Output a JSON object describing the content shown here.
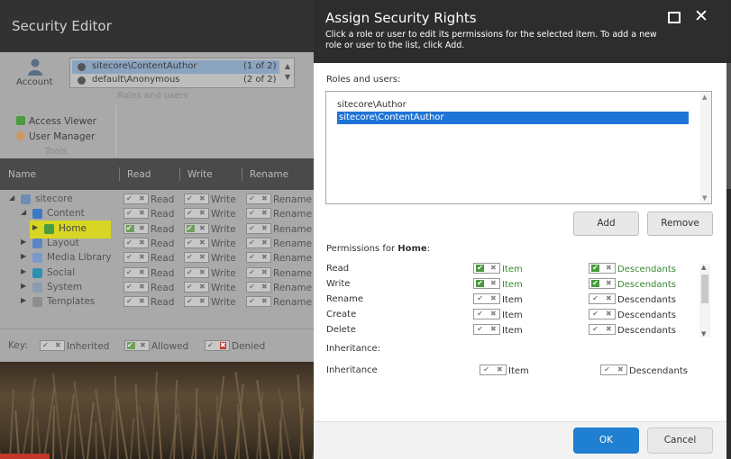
{
  "editor": {
    "title": "Security Editor",
    "ribbon": {
      "account_label": "Account",
      "users": [
        {
          "name": "sitecore\\ContentAuthor",
          "count": "(1 of 2)",
          "selected": true
        },
        {
          "name": "default\\Anonymous",
          "count": "(2 of 2)",
          "selected": false
        }
      ],
      "roles_group_label": "Roles and users",
      "tools": [
        "Access Viewer",
        "User Manager"
      ],
      "tools_group_label": "Tools"
    },
    "grid_headers": [
      "Name",
      "Read",
      "Write",
      "Rename"
    ],
    "tree": [
      {
        "label": "sitecore",
        "level": 0,
        "arrow": "◢"
      },
      {
        "label": "Content",
        "level": 1,
        "arrow": "◢"
      },
      {
        "label": "Home",
        "level": 2,
        "arrow": "▶",
        "highlighted": true,
        "allowed": true
      },
      {
        "label": "Layout",
        "level": 1,
        "arrow": "▶"
      },
      {
        "label": "Media Library",
        "level": 1,
        "arrow": "▶"
      },
      {
        "label": "Social",
        "level": 1,
        "arrow": "▶"
      },
      {
        "label": "System",
        "level": 1,
        "arrow": "▶"
      },
      {
        "label": "Templates",
        "level": 1,
        "arrow": "▶"
      }
    ],
    "perm_cells": [
      "Read",
      "Write",
      "Rename"
    ],
    "key": {
      "label": "Key:",
      "inherited": "Inherited",
      "allowed": "Allowed",
      "denied": "Denied"
    }
  },
  "dialog": {
    "title": "Assign Security Rights",
    "subtitle": "Click a role or user to edit its permissions for the selected item. To add a new role or user to the list, click Add.",
    "roles_label": "Roles and users:",
    "roles": [
      {
        "name": "sitecore\\Author",
        "selected": false
      },
      {
        "name": "sitecore\\ContentAuthor",
        "selected": true
      }
    ],
    "add_label": "Add",
    "remove_label": "Remove",
    "permissions_prefix": "Permissions for",
    "permissions_item": "Home",
    "permissions": [
      {
        "name": "Read",
        "item": "Item",
        "desc": "Descendants",
        "item_allowed": true,
        "desc_allowed": true
      },
      {
        "name": "Write",
        "item": "Item",
        "desc": "Descendants",
        "item_allowed": true,
        "desc_allowed": true
      },
      {
        "name": "Rename",
        "item": "Item",
        "desc": "Descendants",
        "item_allowed": false,
        "desc_allowed": false
      },
      {
        "name": "Create",
        "item": "Item",
        "desc": "Descendants",
        "item_allowed": false,
        "desc_allowed": false
      },
      {
        "name": "Delete",
        "item": "Item",
        "desc": "Descendants",
        "item_allowed": false,
        "desc_allowed": false
      }
    ],
    "inheritance_header": "Inheritance:",
    "inheritance": {
      "name": "Inheritance",
      "item": "Item",
      "desc": "Descendants"
    },
    "ok_label": "OK",
    "cancel_label": "Cancel"
  },
  "colors": {
    "dialog_header": "#2d2d2d",
    "selection": "#1e74d6",
    "allowed_green": "#4a9a3f",
    "ok_blue": "#1f7fd0",
    "highlight_yellow": "#d8d624"
  }
}
